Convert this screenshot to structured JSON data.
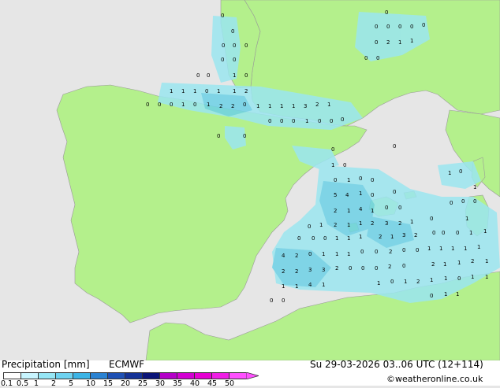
{
  "legend": {
    "title": "Precipitation [mm]",
    "model": "ECMWF",
    "datetime": "Su 29-03-2026 03..06 UTC (12+114)",
    "credit": "©weatheronline.co.uk",
    "scale_labels": [
      "0.1",
      "0.5",
      "1",
      "2",
      "5",
      "10",
      "15",
      "20",
      "25",
      "30",
      "35",
      "40",
      "45",
      "50"
    ],
    "scale_colors": [
      "#ffffff",
      "#c8f5ff",
      "#96e6f5",
      "#6ed2f0",
      "#3cb4e6",
      "#2a82d2",
      "#1e50b4",
      "#143296",
      "#0a1478",
      "#b400c8",
      "#d200d2",
      "#e600d2",
      "#f01ee6",
      "#ff50ff"
    ]
  },
  "colors": {
    "sea": "#e6e6e6",
    "land": "#b4f08c",
    "light_precip": "#9be6f0",
    "medium_precip": "#6ed2e6",
    "heavy_precip": "#3cb4dc"
  },
  "map_values": [
    "0",
    "1",
    "2",
    "3",
    "4",
    "5"
  ]
}
